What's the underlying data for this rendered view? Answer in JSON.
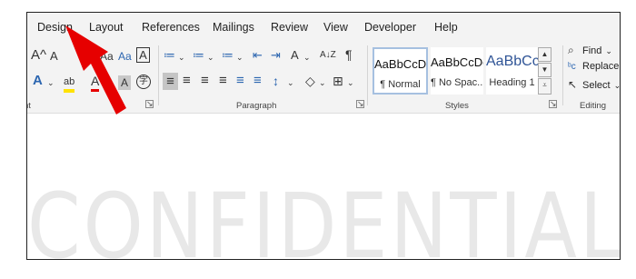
{
  "tabs": [
    "Design",
    "Layout",
    "References",
    "Mailings",
    "Review",
    "View",
    "Developer",
    "Help"
  ],
  "font_group": {
    "label": "nt",
    "grow_font_icon": "A^",
    "shrink_font_icon": "A",
    "change_case_icon": "Aa",
    "clear_formatting_icon": "Aa",
    "character_border_icon": "A",
    "text_effects_icon": "A",
    "highlight_icon": "ab",
    "font_color_icon": "A",
    "character_shading_icon": "A",
    "enclose_characters_icon": "字"
  },
  "paragraph_group": {
    "label": "Paragraph",
    "bullets_icon": "≔",
    "numbering_icon": "≔",
    "multilevel_list_icon": "≔",
    "decrease_indent_icon": "⇤",
    "increase_indent_icon": "⇥",
    "asian_layout_icon": "A",
    "sort_icon": "A↓Z",
    "show_marks_icon": "¶",
    "align_left_icon": "≡",
    "center_icon": "≡",
    "align_right_icon": "≡",
    "justify_icon": "≡",
    "distributed_icon": "≡",
    "column_icon": "≡",
    "line_spacing_icon": "↕",
    "shading_icon": "◇",
    "borders_icon": "⊞"
  },
  "styles_group": {
    "label": "Styles",
    "items": [
      {
        "sample": "AaBbCcDc",
        "name": "¶ Normal"
      },
      {
        "sample": "AaBbCcDc",
        "name": "¶ No Spac..."
      },
      {
        "sample": "AaBbCc",
        "name": "Heading 1"
      }
    ]
  },
  "editing_group": {
    "label": "Editing",
    "find_label": "Find",
    "replace_label": "Replace",
    "select_label": "Select"
  },
  "document": {
    "watermark": "CONFIDENTIAL"
  },
  "colors": {
    "ribbon_bg": "#f3f3f3",
    "accent_blue": "#2c66b0",
    "heading_blue": "#2f5496",
    "arrow_red": "#e60000",
    "watermark_gray": "#e8e8e8"
  }
}
